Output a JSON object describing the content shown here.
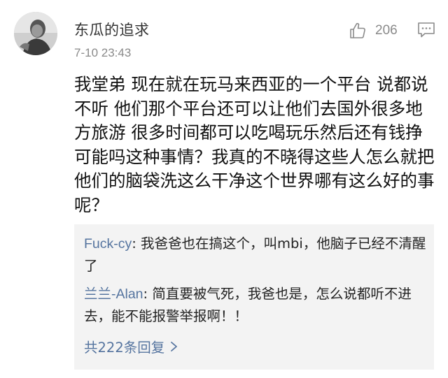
{
  "comment": {
    "username": "东瓜的追求",
    "timestamp": "7-10 23:43",
    "like_count": "206",
    "body": "我堂弟 现在就在玩马来西亚的一个平台 说都说不听 他们那个平台还可以让他们去国外很多地方旅游 很多时间都可以吃喝玩乐然后还有钱挣 可能吗这种事情？我真的不晓得这些人怎么就把他们的脑袋洗这么干净这个世界哪有这么好的事呢？"
  },
  "replies": [
    {
      "user": "Fuck-cy",
      "separator": ": ",
      "text": "我爸爸也在搞这个，叫mbi，他脑子已经不清醒了"
    },
    {
      "user": "兰兰-Alan",
      "separator": ": ",
      "text": "简直要被气死，我爸也是，怎么说都听不进去，能不能报警举报啊！！"
    }
  ],
  "more_replies_label": "共222条回复",
  "icons": {
    "like": "thumbs-up-icon",
    "comment": "comment-icon",
    "more": "chevron-right-icon"
  },
  "colors": {
    "link": "#55749f",
    "meta": "#8a8a8a",
    "reply_bg": "#f3f3f3"
  }
}
